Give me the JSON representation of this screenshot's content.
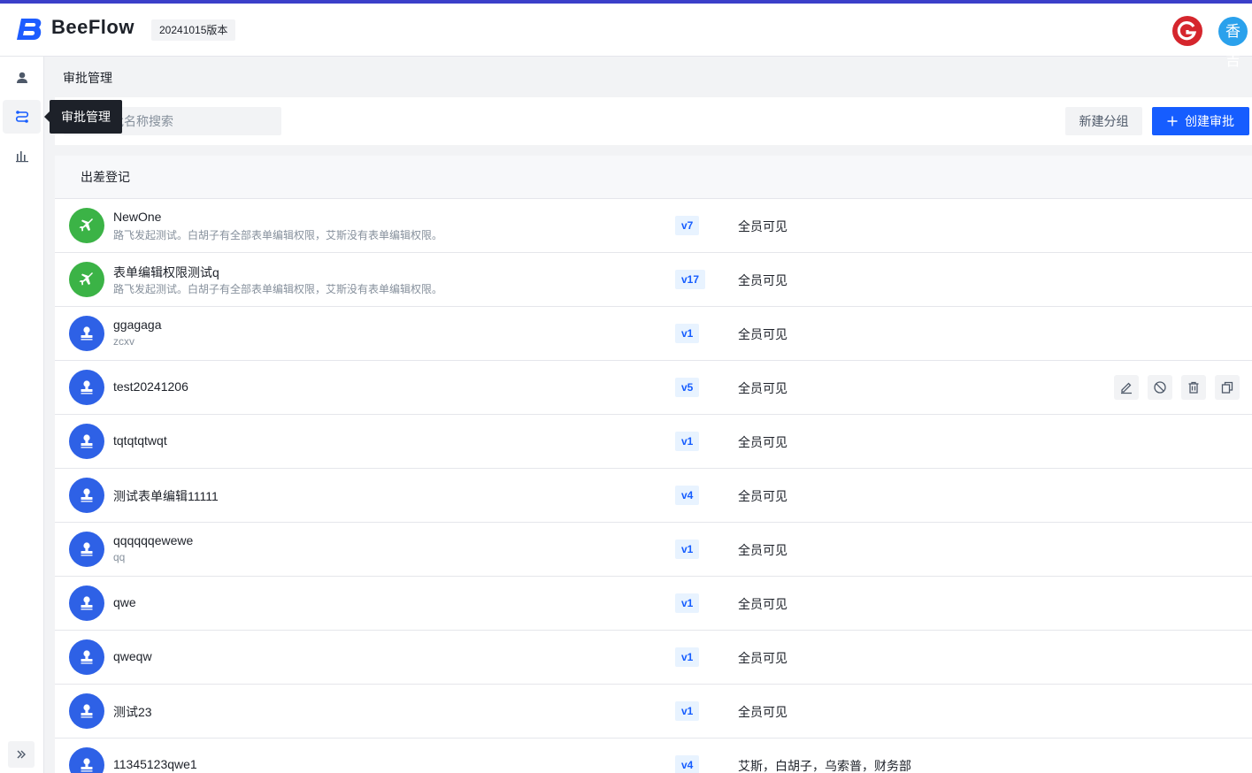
{
  "header": {
    "logo_text": "BeeFlow",
    "version_tag": "20241015版本",
    "avatar_text": "香吉"
  },
  "sidebar": {
    "items": [
      {
        "icon": "user-icon",
        "label": "用户"
      },
      {
        "icon": "flow-icon",
        "label": "审批管理",
        "active": true
      },
      {
        "icon": "bar-chart-icon",
        "label": "统计"
      }
    ],
    "expand_icon": "double-chevron-right-icon"
  },
  "tooltip": "审批管理",
  "breadcrumb": "审批管理",
  "toolbar": {
    "search_placeholder": "输入审批名称搜索",
    "new_group_label": "新建分组",
    "create_label": "创建审批"
  },
  "group": {
    "title": "出差登记",
    "rows": [
      {
        "name": "NewOne",
        "desc": "路飞发起测试。白胡子有全部表单编辑权限，艾斯没有表单编辑权限。",
        "version": "v7",
        "visibility": "全员可见",
        "icon": "plane-icon",
        "color": "green"
      },
      {
        "name": "表单编辑权限测试q",
        "desc": "路飞发起测试。白胡子有全部表单编辑权限，艾斯没有表单编辑权限。",
        "version": "v17",
        "visibility": "全员可见",
        "icon": "plane-icon",
        "color": "green"
      },
      {
        "name": "ggagaga",
        "desc": "zcxv",
        "version": "v1",
        "visibility": "全员可见",
        "icon": "stamp-icon",
        "color": "blue"
      },
      {
        "name": "test20241206",
        "desc": "",
        "version": "v5",
        "visibility": "全员可见",
        "icon": "stamp-icon",
        "color": "blue",
        "hover": true
      },
      {
        "name": "tqtqtqtwqt",
        "desc": "",
        "version": "v1",
        "visibility": "全员可见",
        "icon": "stamp-icon",
        "color": "blue"
      },
      {
        "name": "测试表单编辑11111",
        "desc": "",
        "version": "v4",
        "visibility": "全员可见",
        "icon": "stamp-icon",
        "color": "blue"
      },
      {
        "name": "qqqqqqewewe",
        "desc": "qq",
        "version": "v1",
        "visibility": "全员可见",
        "icon": "stamp-icon",
        "color": "blue"
      },
      {
        "name": "qwe",
        "desc": "",
        "version": "v1",
        "visibility": "全员可见",
        "icon": "stamp-icon",
        "color": "blue"
      },
      {
        "name": "qweqw",
        "desc": "",
        "version": "v1",
        "visibility": "全员可见",
        "icon": "stamp-icon",
        "color": "blue"
      },
      {
        "name": "测试23",
        "desc": "",
        "version": "v1",
        "visibility": "全员可见",
        "icon": "stamp-icon",
        "color": "blue"
      },
      {
        "name": "11345123qwe1",
        "desc": "",
        "version": "v4",
        "visibility": "艾斯，白胡子，乌索普，财务部",
        "icon": "stamp-icon",
        "color": "blue"
      }
    ],
    "row_actions": [
      {
        "icon": "edit-icon",
        "label": "编辑"
      },
      {
        "icon": "disable-icon",
        "label": "停用"
      },
      {
        "icon": "delete-icon",
        "label": "删除"
      },
      {
        "icon": "copy-icon",
        "label": "复制"
      }
    ]
  }
}
